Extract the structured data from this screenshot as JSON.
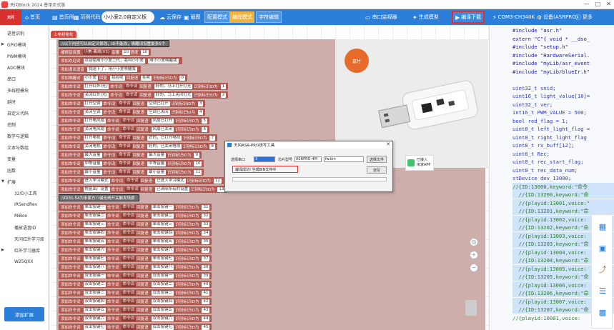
{
  "window": {
    "title": "天问Block 2024 普单正式版",
    "controls": [
      "—",
      "□",
      "✕"
    ]
  },
  "toolbar": {
    "brand": "天问",
    "home": "首页",
    "examples": "首页例",
    "code_examples": "范例代码",
    "device_select": "小小爱2.0自定义板",
    "cloud_save": "云保存",
    "screenshot": "截图",
    "config_mode": "配置模式",
    "compile_mode": "编程模式",
    "char_edit": "字符编辑",
    "serial_monitor": "串口监视器",
    "gen_model": "生成模型",
    "download": "编译下载",
    "port": "COM3-CH340K",
    "device_settings": "设备(ASRPRO)",
    "more": "更多"
  },
  "sidebar": {
    "items": [
      {
        "label": "语音识别",
        "arrow": ""
      },
      {
        "label": "GPIO模块",
        "arrow": "▶"
      },
      {
        "label": "PWM模块",
        "arrow": ""
      },
      {
        "label": "ADC模块",
        "arrow": ""
      },
      {
        "label": "串口",
        "arrow": ""
      },
      {
        "label": "多线程模块",
        "arrow": ""
      },
      {
        "label": "延时",
        "arrow": ""
      },
      {
        "label": "自定义代码",
        "arrow": ""
      },
      {
        "label": "控制",
        "arrow": ""
      },
      {
        "label": "数学与逻辑",
        "arrow": ""
      },
      {
        "label": "文本与数组",
        "arrow": ""
      },
      {
        "label": "变量",
        "arrow": ""
      },
      {
        "label": "函数",
        "arrow": ""
      },
      {
        "label": "扩展",
        "arrow": "▼"
      },
      {
        "label": "32位小工具",
        "arrow": ""
      },
      {
        "label": "IRSendRev",
        "arrow": ""
      },
      {
        "label": "MiBox",
        "arrow": ""
      },
      {
        "label": "播放语音ID",
        "arrow": ""
      },
      {
        "label": "天问红外学习库",
        "arrow": ""
      },
      {
        "label": "红外学习器库",
        "arrow": "▶"
      },
      {
        "label": "W25QXX",
        "arrow": ""
      }
    ],
    "add_extension": "添加扩展"
  },
  "workspace": {
    "hat_label": "上电初始化",
    "comment1": "//以下内容可以自定义修改，ID不能改，唤醒词设置最多5个",
    "settings_row": {
      "a": "播报音设置",
      "b": "小美-离线(V3)",
      "c": "音量",
      "d": "10",
      "e": "语速",
      "f": "10"
    },
    "welcome_row": {
      "a": "添加欢迎词",
      "b": "欢迎使用小小爱二代，我叫小小爱",
      "c": "用小小爱唤醒我"
    },
    "exit_row": {
      "a": "添加退出语音",
      "b": "我退下了，用小小爱唤醒我"
    },
    "wake_row": {
      "a": "添加唤醒词",
      "b": "小小爱",
      "c": "回复",
      "d": "我在呢",
      "e": "回复语",
      "f": "在呢",
      "g": "识别标识ID为",
      "h": "0"
    },
    "cmd_rows": [
      {
        "a": "打开红外(光)",
        "b": "关灯",
        "c": "好的，马上打开灯光",
        "d": "1"
      },
      {
        "a": "关闭红外(光)",
        "b": "关灯",
        "c": "好的，马上关闭灯光",
        "d": "2"
      },
      {
        "a": "打开空调",
        "b": "开空调",
        "c": "空调已打开",
        "d": "3"
      },
      {
        "a": "关闭空调",
        "b": "关空调",
        "c": "空调已关闭",
        "d": "4"
      },
      {
        "a": "打开电风扇",
        "b": "开风扇",
        "c": "风扇已打开",
        "d": "5"
      },
      {
        "a": "关闭电风扇",
        "b": "关风扇",
        "c": "风扇已关闭",
        "d": "6"
      },
      {
        "a": "打开电视",
        "b": "开电视",
        "c": "好的，已打开电视",
        "d": "7"
      },
      {
        "a": "关闭电视",
        "b": "关电视",
        "c": "好的，已关闭电视",
        "d": "8"
      },
      {
        "a": "最大音量",
        "b": "最大音量",
        "c": "最大音量",
        "d": "9"
      },
      {
        "a": "中等音量",
        "b": "中等音量",
        "c": "中等音量",
        "d": "10"
      },
      {
        "a": "最小音量",
        "b": "最小音量",
        "c": "最小音量",
        "d": "11"
      },
      {
        "a": "进入学习模式",
        "b": "学习模式",
        "c": "已进入学习模式",
        "d": "12"
      },
      {
        "a": "恢复出厂设置",
        "b": "恢复出厂设置",
        "c": "已清除所有的设置",
        "d": "13"
      }
    ],
    "comment2": "//ID31-54为米家方八键无线开关触发场景",
    "key_rows": [
      {
        "a": "单击按键一",
        "d": "31"
      },
      {
        "a": "单击按键二",
        "d": "32"
      },
      {
        "a": "单击按键三",
        "d": "33"
      },
      {
        "a": "单击按键四",
        "d": "34"
      },
      {
        "a": "单击按键五",
        "d": "35"
      },
      {
        "a": "单击按键六",
        "d": "36"
      },
      {
        "a": "单击按键七",
        "d": "37"
      },
      {
        "a": "单击按键八",
        "d": "38"
      },
      {
        "a": "双击按键一",
        "d": "39"
      },
      {
        "a": "双击按键二",
        "d": "40"
      },
      {
        "a": "双击按键三",
        "d": "41"
      },
      {
        "a": "双击按键四",
        "d": "42"
      },
      {
        "a": "双击按键五",
        "d": "43"
      },
      {
        "a": "双击按键六",
        "d": "44"
      },
      {
        "a": "双击按键七",
        "d": "45"
      }
    ],
    "block_add": "添加命令词",
    "block_cmd": "命令词",
    "block_reply": "回复语",
    "block_id": "识别标识ID为",
    "product_logo": "嘉竹",
    "mi_badge": "已接入\n米家APP"
  },
  "dialog": {
    "title": "天问ASR-PRO烧写工具",
    "port_label": "选择串口",
    "port_value": "3",
    "chip_label": "芯片型号",
    "chip_value": "ASRPRO-4M",
    "file_value": "fw.bin",
    "select_file": "选择文件",
    "burn": "烧写",
    "status": "编译成功! 生成BIN文件中",
    "close": "✕"
  },
  "code": {
    "lines": [
      {
        "t": "#include \"asr.h\"",
        "cls": "kw",
        "sel": false
      },
      {
        "t": "extern \"C\"{ void * __dso_",
        "cls": "kw",
        "sel": false
      },
      {
        "t": "#include \"setup.h\"",
        "cls": "kw",
        "sel": false
      },
      {
        "t": "#include \"HardwareSerial.",
        "cls": "kw",
        "sel": false
      },
      {
        "t": "#include \"myLib/asr_event",
        "cls": "kw",
        "sel": false
      },
      {
        "t": "#include \"myLib/blueIr.h\"",
        "cls": "kw",
        "sel": false
      },
      {
        "t": "",
        "cls": "",
        "sel": false
      },
      {
        "t": "uint32_t snid;",
        "cls": "ty",
        "sel": false
      },
      {
        "t": "uint16_t light_value[10]=",
        "cls": "ty",
        "sel": false
      },
      {
        "t": "uint32_t ver;",
        "cls": "ty",
        "sel": false
      },
      {
        "t": "int16_t PWM_VALUE = 500;",
        "cls": "ty",
        "sel": false
      },
      {
        "t": "bool red_flag = 1;",
        "cls": "ty",
        "sel": false
      },
      {
        "t": "uint8_t left_light_flag =",
        "cls": "ty",
        "sel": false
      },
      {
        "t": "uint8_t right_light_flag",
        "cls": "ty",
        "sel": false
      },
      {
        "t": "uint8_t rx_buff[12];",
        "cls": "ty",
        "sel": false
      },
      {
        "t": "uint8_t Rec;",
        "cls": "ty",
        "sel": false
      },
      {
        "t": "uint8_t rec_start_flag;",
        "cls": "ty",
        "sel": false
      },
      {
        "t": "uint8_t rec_data_num;",
        "cls": "ty",
        "sel": false
      },
      {
        "t": "stDevice dev_13000;",
        "cls": "ty",
        "sel": false
      },
      {
        "t": "//{ID:13000,keyword:\"命令",
        "cls": "cm",
        "sel": true
      },
      {
        "t": "  //{ID:13200,keyword:\"命",
        "cls": "cm",
        "sel": true
      },
      {
        "t": "  //{playid:13001,voice:\"",
        "cls": "cm",
        "sel": true
      },
      {
        "t": "  //{ID:13201,keyword:\"命",
        "cls": "cm",
        "sel": true
      },
      {
        "t": "  //{playid:13002,voice:",
        "cls": "cm",
        "sel": true
      },
      {
        "t": "  //{ID:13202,keyword:\"命",
        "cls": "cm",
        "sel": true
      },
      {
        "t": "  //{playid:13003,voice:",
        "cls": "cm",
        "sel": true
      },
      {
        "t": "  //{ID:13203,keyword:\"命",
        "cls": "cm",
        "sel": true
      },
      {
        "t": "  //{playid:13004,voice:",
        "cls": "cm",
        "sel": true
      },
      {
        "t": "  //{ID:13204,keyword:\"命",
        "cls": "cm",
        "sel": true
      },
      {
        "t": "  //{playid:13005,voice:",
        "cls": "cm",
        "sel": true
      },
      {
        "t": "  //{ID:13205,keyword:\"命",
        "cls": "cm",
        "sel": true
      },
      {
        "t": "  //{playid:13006,voice:",
        "cls": "cm",
        "sel": true
      },
      {
        "t": "  //{ID:13206,keyword:\"命",
        "cls": "cm",
        "sel": true
      },
      {
        "t": "  //{playid:13007,voice:",
        "cls": "cm",
        "sel": true
      },
      {
        "t": "  //{ID:13207,keyword:\"命",
        "cls": "cm",
        "sel": true
      },
      {
        "t": "//{playid:10001,voice:",
        "cls": "cm",
        "sel": false
      }
    ]
  },
  "side_tools": [
    "chart-icon",
    "image-icon",
    "share-icon",
    "list-icon",
    "qr-icon"
  ],
  "colors": {
    "toolbar": "#2b7fd8",
    "brand": "#d9312f",
    "block": "#b05a52",
    "highlight": "#e03030",
    "code_selection": "#cfe3fb"
  }
}
